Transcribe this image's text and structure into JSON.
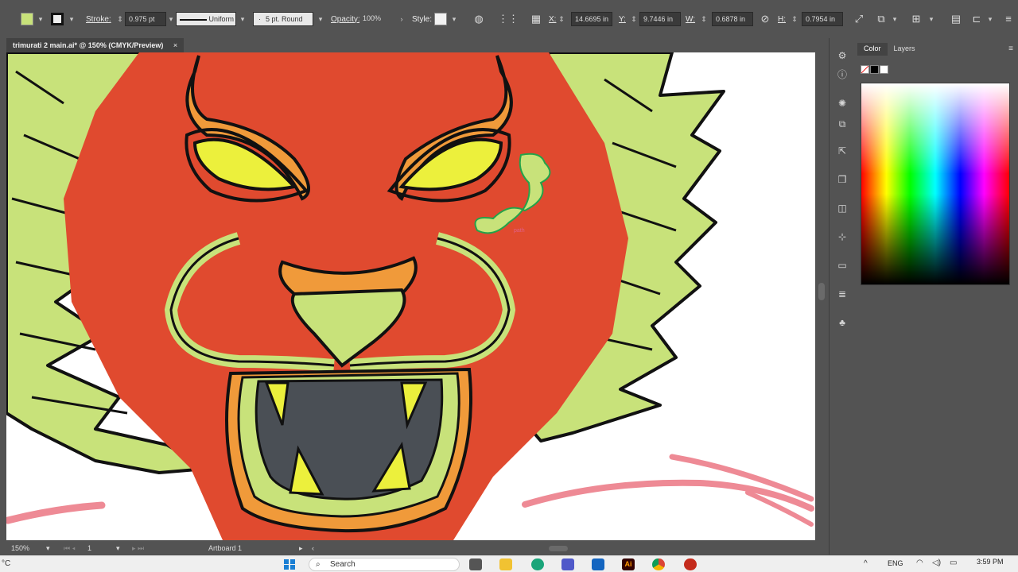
{
  "document_tab": {
    "title": "trimurati 2 main.ai* @ 150% (CMYK/Preview)",
    "close": "×"
  },
  "control_bar": {
    "stroke_label": "Stroke:",
    "stroke_value": "0.975 pt",
    "profile_value": "Uniform",
    "brush_value": "5 pt. Round",
    "opacity_label": "Opacity:",
    "opacity_value": "100%",
    "style_label": "Style:",
    "x_label": "X:",
    "x_value": "14.6695 in",
    "y_label": "Y:",
    "y_value": "9.7446 in",
    "w_label": "W:",
    "w_value": "0.6878 in",
    "h_label": "H:",
    "h_value": "0.7954 in",
    "fill_color": "#c8e27a"
  },
  "canvas": {
    "hover_label": "path"
  },
  "status_bar": {
    "zoom": "150%",
    "artboard_number": "1",
    "artboard_name": "Artboard 1"
  },
  "panel": {
    "tabs": [
      "Color",
      "Layers"
    ],
    "active_tab": "Color"
  },
  "right_strip_icons": [
    "properties-icon",
    "info-icon",
    "brightness-icon",
    "transform-icon",
    "export-icon",
    "3d-icon",
    "pathfinder-icon",
    "align-icon",
    "gradient-icon",
    "layers-stack-icon",
    "club-icon"
  ],
  "taskbar": {
    "search_placeholder": "Search",
    "language": "ENG",
    "time": "3:59 PM",
    "temp_unit": "°C"
  },
  "colors": {
    "face_red": "#e04a2f",
    "mane_green": "#c8e27a",
    "eye_yellow": "#ecf03c",
    "orange": "#f09a3a",
    "mouth_gray": "#4a4f55",
    "pink_stroke": "#ee8a95"
  }
}
